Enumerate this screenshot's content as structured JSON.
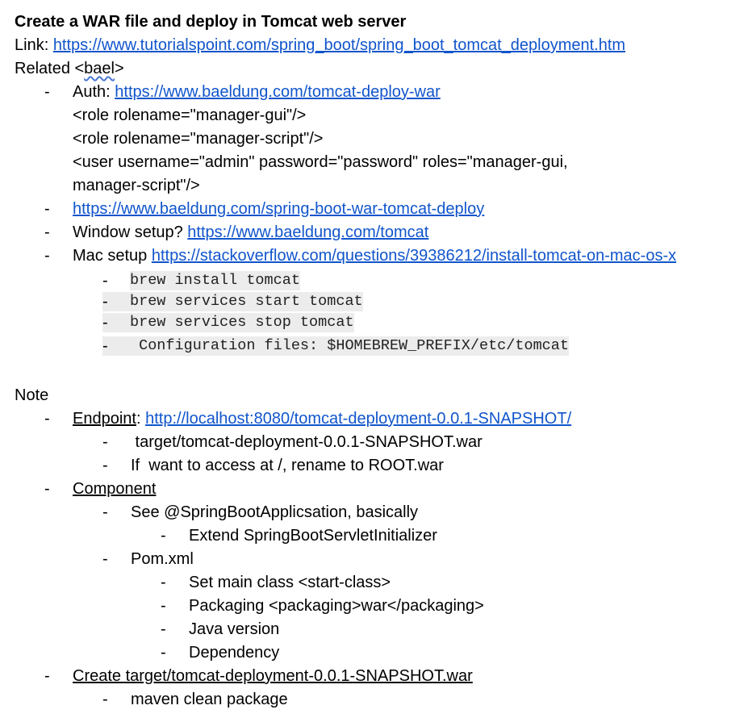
{
  "title": "Create a WAR file and deploy in Tomcat web server",
  "link_label": "Link: ",
  "link_url": "https://www.tutorialspoint.com/spring_boot/spring_boot_tomcat_deployment.htm",
  "related_prefix": "Related <",
  "related_word": "bael",
  "related_suffix": ">",
  "auth_label": "Auth: ",
  "auth_url": "https://www.baeldung.com/tomcat-deploy-war",
  "role1": "<role rolename=\"manager-gui\"/>",
  "role2": "<role rolename=\"manager-script\"/>",
  "user_line1": "<user username=\"admin\" password=\"password\" roles=\"manager-gui,",
  "user_line2": "manager-script\"/>",
  "war_url": "https://www.baeldung.com/spring-boot-war-tomcat-deploy",
  "window_label": "Window setup? ",
  "window_url": "https://www.baeldung.com/tomcat",
  "mac_label": "Mac setup ",
  "mac_url": "https://stackoverflow.com/questions/39386212/install-tomcat-on-mac-os-x",
  "code_lines": [
    "brew install tomcat",
    "brew services start tomcat",
    "brew services stop tomcat",
    " Configuration files: $HOMEBREW_PREFIX/etc/tomcat"
  ],
  "note_heading": "Note",
  "endpoint_label": "Endpoint",
  "endpoint_colon": ": ",
  "endpoint_url": "http://localhost:8080/tomcat-deployment-0.0.1-SNAPSHOT/",
  "endpoint_sub1": " target/tomcat-deployment-0.0.1-SNAPSHOT.war",
  "endpoint_sub2": "If  want to access at /, rename to ROOT.war",
  "component_label": "Component",
  "component_see": "See @SpringBootApplicsation, basically",
  "component_extend": "Extend SpringBootServletInitializer",
  "pom": "Pom.xml",
  "pom_items": [
    "Set main class <start-class>",
    "Packaging <packaging>war</packaging>",
    "Java version",
    "Dependency"
  ],
  "create_label": "Create target/tomcat-deployment-0.0.1-SNAPSHOT.war",
  "create_sub": "maven clean package",
  "bullet_char": "-"
}
